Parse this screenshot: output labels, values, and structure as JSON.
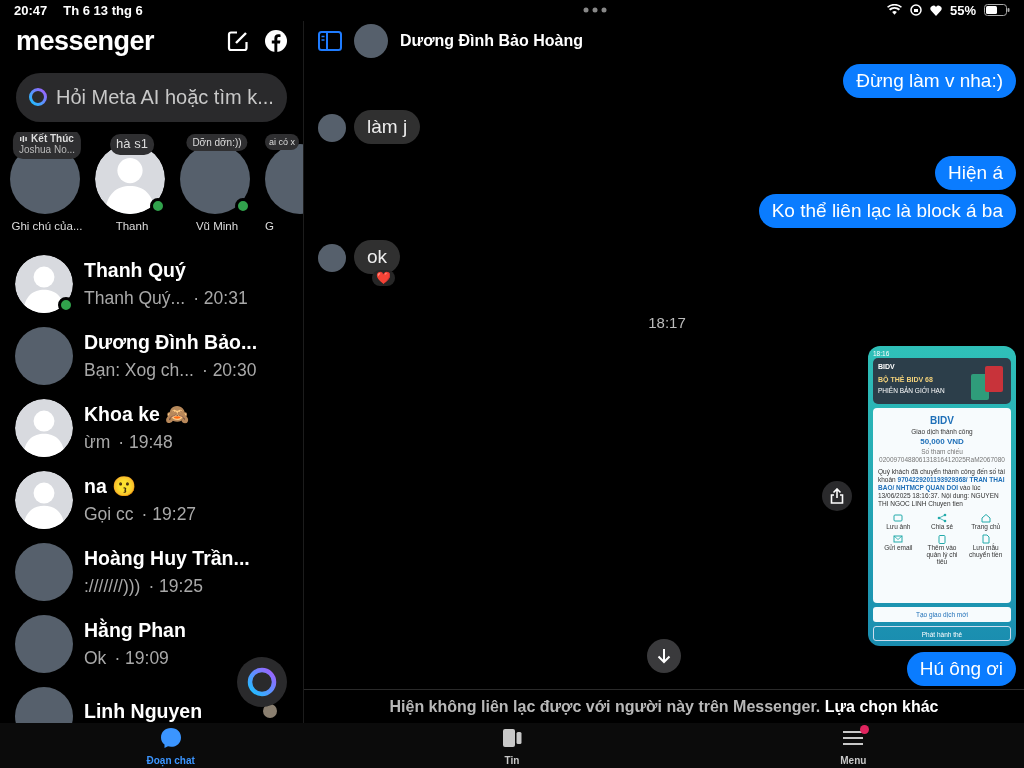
{
  "status_bar": {
    "time": "20:47",
    "date": "Th 6 13 thg 6",
    "battery": "55%"
  },
  "sidebar": {
    "title": "messenger",
    "search": {
      "placeholder": "Hỏi Meta AI hoặc tìm k..."
    },
    "stories": [
      {
        "note": "Kết Thúc",
        "note_sub": "Joshua No...",
        "name": "Ghi chú của...",
        "photo": true,
        "online": false
      },
      {
        "note": "hà s1",
        "name": "Thanh",
        "photo": false,
        "online": true
      },
      {
        "note": "Dỡn dỡn:))",
        "name": "Vũ Minh",
        "photo": true,
        "online": true
      },
      {
        "note": "ai có x",
        "name": "G",
        "photo": true,
        "online": false
      }
    ],
    "chats": [
      {
        "name": "Thanh Quý",
        "preview": "Thanh Quý...",
        "time": "· 20:31",
        "photo": false,
        "online": true,
        "seen": false
      },
      {
        "name": "Dương Đình Bảo...",
        "preview": "Bạn: Xog ch...",
        "time": "· 20:30",
        "photo": true,
        "online": false,
        "seen": false
      },
      {
        "name": "Khoa ke 🙈",
        "preview": "ừm",
        "time": "· 19:48",
        "photo": false,
        "online": false,
        "seen": false
      },
      {
        "name": "na 😗",
        "preview": "Gọi cc",
        "time": "· 19:27",
        "photo": false,
        "online": false,
        "seen": false
      },
      {
        "name": "Hoàng Huy Trần...",
        "preview": ":///////)))",
        "time": "· 19:25",
        "photo": true,
        "online": false,
        "seen": false
      },
      {
        "name": "Hằng Phan",
        "preview": "Ok",
        "time": "· 19:09",
        "photo": true,
        "online": false,
        "seen": false
      },
      {
        "name": "Linh Nguyen",
        "photo": true,
        "online": false,
        "seen": true
      }
    ]
  },
  "conversation": {
    "name": "Dương Đình Bảo Hoàng",
    "messages": [
      {
        "kind": "sent",
        "text": "Đừng làm v nha:)"
      },
      {
        "kind": "received",
        "text": "làm j"
      },
      {
        "kind": "sent",
        "text": "Hiện á"
      },
      {
        "kind": "sent",
        "text": "Ko thể liên lạc là block á ba"
      },
      {
        "kind": "received",
        "text": "ok",
        "reaction": "❤️"
      },
      {
        "kind": "time",
        "text": "18:17"
      },
      {
        "kind": "image",
        "receipt": {
          "clock": "18:16",
          "banner_brand": "BIDV",
          "banner_title": "BỘ THẺ BIDV 68",
          "banner_sub": "PHIÊN BẢN GIỚI HẠN",
          "brand": "BIDV",
          "status": "Giao dịch thành công",
          "amount": "50,000 VND",
          "ref_label": "Số tham chiếu",
          "ref": "020097048806131816412025RaM2067080",
          "detail": "Quý khách đã chuyển thành công đến số tài khoản **9704229201193929368/ TRAN THAI BAO/ NHTMCP QUAN DOI** vào lúc 13/06/2025 18:16:37. Nội dung: NGUYEN THI NGOC LINH Chuyen tien",
          "actions": [
            "Lưu ảnh",
            "Chia sẻ",
            "Trang chủ",
            "Gửi email",
            "Thêm vào quản lý chi tiêu",
            "Lưu mẫu chuyển tiền"
          ],
          "buttons": [
            "Tạo giao dịch mới",
            "Phát hành thẻ"
          ]
        }
      },
      {
        "kind": "sent",
        "text": "Hú ông ơi"
      }
    ],
    "notice": "Hiện không liên lạc được với người này trên Messenger.",
    "notice_link": "Lựa chọn khác"
  },
  "tabs": [
    {
      "label": "Đoạn chat",
      "selected": true,
      "badge": false
    },
    {
      "label": "Tin",
      "selected": false,
      "badge": false
    },
    {
      "label": "Menu",
      "selected": false,
      "badge": true
    }
  ]
}
